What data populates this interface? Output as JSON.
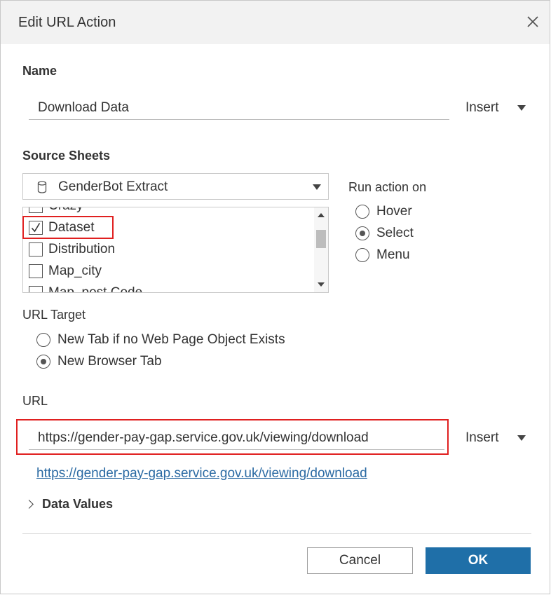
{
  "dialog": {
    "title": "Edit URL Action"
  },
  "name_section": {
    "label": "Name",
    "value": "Download Data",
    "insert_label": "Insert"
  },
  "source_sheets": {
    "label": "Source Sheets",
    "data_source": "GenderBot Extract",
    "items": [
      {
        "label": "Crazy",
        "checked": false
      },
      {
        "label": "Dataset",
        "checked": true
      },
      {
        "label": "Distribution",
        "checked": false
      },
      {
        "label": "Map_city",
        "checked": false
      },
      {
        "label": "Map_post Code",
        "checked": false
      }
    ]
  },
  "run_action": {
    "label": "Run action on",
    "options": [
      {
        "label": "Hover",
        "selected": false
      },
      {
        "label": "Select",
        "selected": true
      },
      {
        "label": "Menu",
        "selected": false
      }
    ]
  },
  "url_target": {
    "label": "URL Target",
    "options": [
      {
        "label": "New Tab if no Web Page Object Exists",
        "selected": false
      },
      {
        "label": "New Browser Tab",
        "selected": true
      }
    ]
  },
  "url_section": {
    "label": "URL",
    "value": "https://gender-pay-gap.service.gov.uk/viewing/download",
    "insert_label": "Insert",
    "preview_link": "https://gender-pay-gap.service.gov.uk/viewing/download"
  },
  "data_values": {
    "label": "Data Values"
  },
  "buttons": {
    "cancel": "Cancel",
    "ok": "OK"
  },
  "colors": {
    "highlight": "#e02020",
    "primary": "#1f6fa8",
    "link": "#2b6aa3"
  }
}
